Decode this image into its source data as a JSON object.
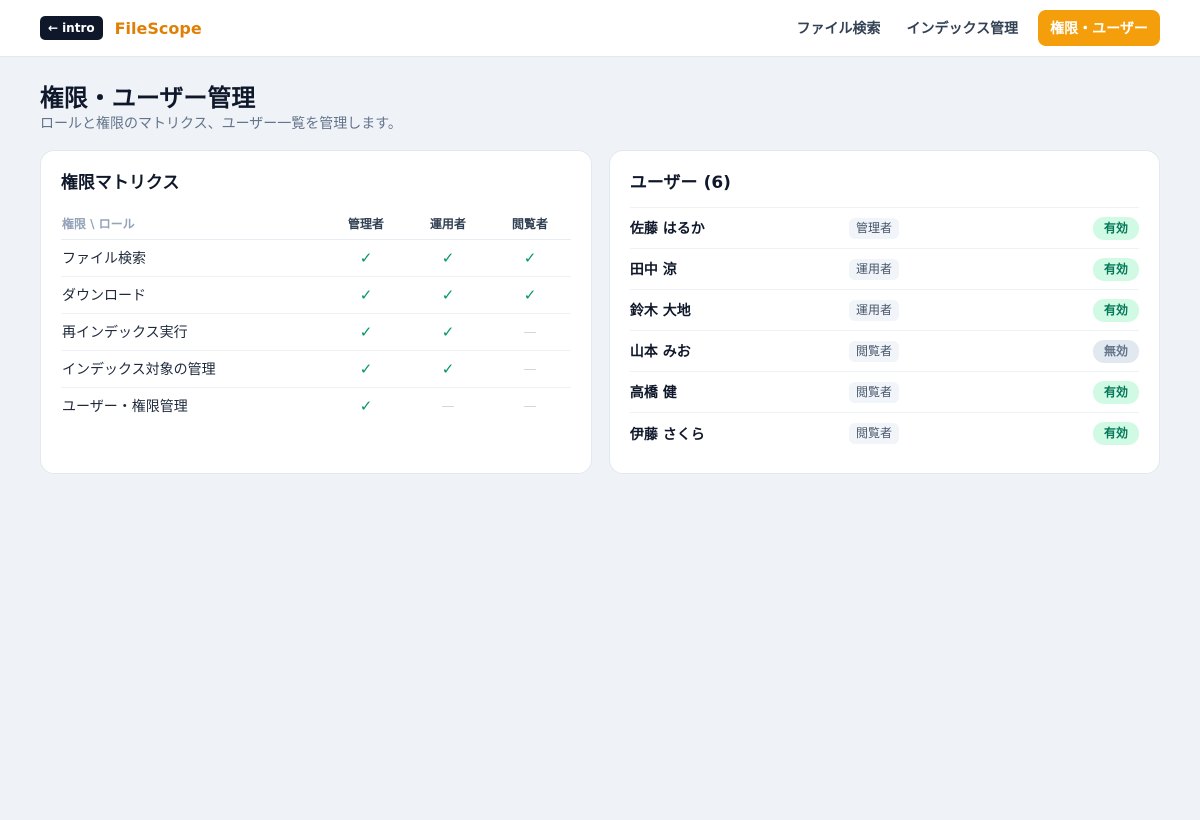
{
  "header": {
    "back_label": "intro",
    "brand": "FileScope",
    "nav": [
      {
        "label": "ファイル検索",
        "active": false
      },
      {
        "label": "インデックス管理",
        "active": false
      },
      {
        "label": "権限・ユーザー",
        "active": true
      }
    ]
  },
  "page": {
    "title": "権限・ユーザー管理",
    "subtitle": "ロールと権限のマトリクス、ユーザー一覧を管理します。"
  },
  "matrix": {
    "title": "権限マトリクス",
    "corner_header": "権限 \\ ロール",
    "roles": [
      "管理者",
      "運用者",
      "閲覧者"
    ],
    "rows": [
      {
        "permission": "ファイル検索",
        "allowed": [
          true,
          true,
          true
        ]
      },
      {
        "permission": "ダウンロード",
        "allowed": [
          true,
          true,
          true
        ]
      },
      {
        "permission": "再インデックス実行",
        "allowed": [
          true,
          true,
          false
        ]
      },
      {
        "permission": "インデックス対象の管理",
        "allowed": [
          true,
          true,
          false
        ]
      },
      {
        "permission": "ユーザー・権限管理",
        "allowed": [
          true,
          false,
          false
        ]
      }
    ],
    "check_glyph": "✓",
    "dash_glyph": "—"
  },
  "users": {
    "title": "ユーザー (6)",
    "items": [
      {
        "name": "佐藤 はるか",
        "role": "管理者",
        "status": "有効",
        "active": true
      },
      {
        "name": "田中 涼",
        "role": "運用者",
        "status": "有効",
        "active": true
      },
      {
        "name": "鈴木 大地",
        "role": "運用者",
        "status": "有効",
        "active": true
      },
      {
        "name": "山本 みお",
        "role": "閲覧者",
        "status": "無効",
        "active": false
      },
      {
        "name": "高橋 健",
        "role": "閲覧者",
        "status": "有効",
        "active": true
      },
      {
        "name": "伊藤 さくら",
        "role": "閲覧者",
        "status": "有効",
        "active": true
      }
    ]
  },
  "colors": {
    "brand": "#e07f06",
    "nav_active": "#f59e0b",
    "check": "#059669",
    "status_on_bg": "#d1fae5",
    "status_off_bg": "#e2e8f0"
  }
}
